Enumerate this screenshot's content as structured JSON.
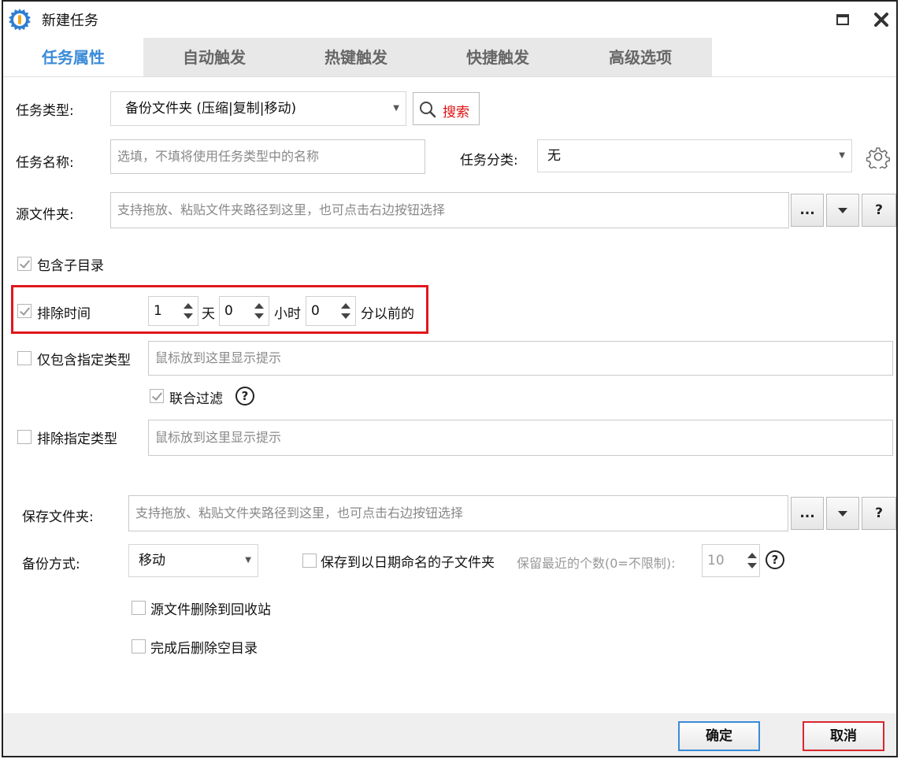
{
  "window": {
    "title": "新建任务"
  },
  "tabs": [
    {
      "label": "任务属性",
      "active": true
    },
    {
      "label": "自动触发",
      "active": false
    },
    {
      "label": "热键触发",
      "active": false
    },
    {
      "label": "快捷触发",
      "active": false
    },
    {
      "label": "高级选项",
      "active": false
    }
  ],
  "task_type": {
    "label": "任务类型:",
    "value": "备份文件夹 (压缩|复制|移动)",
    "search_label": "搜索"
  },
  "task_name": {
    "label": "任务名称:",
    "placeholder": "选填，不填将使用任务类型中的名称"
  },
  "task_category": {
    "label": "任务分类:",
    "value": "无"
  },
  "source_folder": {
    "label": "源文件夹:",
    "placeholder": "支持拖放、粘贴文件夹路径到这里，也可点击右边按钮选择",
    "browse_label": "...",
    "help_label": "?"
  },
  "include_subdirs": {
    "label": "包含子目录",
    "checked": true
  },
  "exclude_time": {
    "label": "排除时间",
    "checked": true,
    "days": "1",
    "days_unit": "天",
    "hours": "0",
    "hours_unit": "小时",
    "minutes": "0",
    "minutes_suffix": "分以前的"
  },
  "only_types": {
    "label": "仅包含指定类型",
    "checked": false,
    "placeholder": "鼠标放到这里显示提示"
  },
  "joint_filter": {
    "label": "联合过滤",
    "checked": true,
    "help_label": "?"
  },
  "exclude_types": {
    "label": "排除指定类型",
    "checked": false,
    "placeholder": "鼠标放到这里显示提示"
  },
  "save_folder": {
    "label": "保存文件夹:",
    "placeholder": "支持拖放、粘贴文件夹路径到这里，也可点击右边按钮选择",
    "browse_label": "...",
    "help_label": "?"
  },
  "backup_method": {
    "label": "备份方式:",
    "value": "移动"
  },
  "date_subfolder": {
    "label": "保存到以日期命名的子文件夹",
    "checked": false
  },
  "keep_recent": {
    "label": "保留最近的个数(0=不限制):",
    "value": "10",
    "help_label": "?"
  },
  "source_to_recycle": {
    "label": "源文件删除到回收站",
    "checked": false
  },
  "delete_empty_dirs": {
    "label": "完成后删除空目录",
    "checked": false
  },
  "footer": {
    "ok_label": "确定",
    "cancel_label": "取消"
  },
  "colors": {
    "accent": "#3a8bd8",
    "highlight_border": "#e0171c",
    "search_text": "#e01010",
    "cancel_border": "#d9262c",
    "ok_border": "#3a8bd8"
  }
}
